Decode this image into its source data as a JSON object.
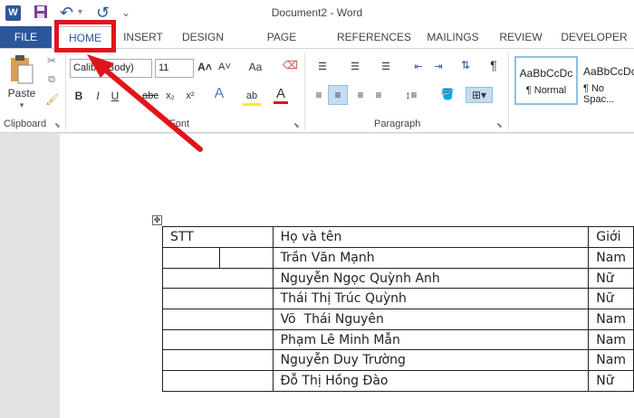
{
  "window": {
    "title": "Document2 - Word"
  },
  "qat": {
    "word_icon": "W",
    "save_icon": "save-icon",
    "undo_icon": "↶",
    "redo_icon": "↺",
    "customize_icon": "⌄"
  },
  "tabs": [
    "FILE",
    "HOME",
    "INSERT",
    "DESIGN",
    "PAGE LAYOUT",
    "REFERENCES",
    "MAILINGS",
    "REVIEW",
    "DEVELOPER"
  ],
  "ribbon": {
    "clipboard": {
      "label": "Clipboard",
      "paste": "Paste"
    },
    "font": {
      "label": "Font",
      "font_name": "Calibri (Body)",
      "font_size": "11",
      "bold": "B",
      "italic": "I",
      "underline": "U",
      "strike": "abc",
      "subscript": "x₂",
      "superscript": "x²",
      "grow": "A˄",
      "shrink": "A˅",
      "case": "Aa",
      "effects": "A",
      "highlight": "ab",
      "color": "A"
    },
    "paragraph": {
      "label": "Paragraph",
      "pilcrow": "¶"
    },
    "styles": [
      {
        "preview": "AaBbCcDc",
        "name": "¶ Normal"
      },
      {
        "preview": "AaBbCcDc",
        "name": "¶ No Spac..."
      }
    ]
  },
  "table": {
    "header": [
      "STT",
      "Họ và tên",
      "Giới"
    ],
    "rows": [
      [
        "",
        "Trần Văn Mạnh",
        "Nam"
      ],
      [
        "",
        "Nguyễn Ngọc Quỳnh Anh",
        "Nữ"
      ],
      [
        "",
        "Thái Thị Trúc Quỳnh",
        "Nữ"
      ],
      [
        "",
        "Võ  Thái Nguyên",
        "Nam"
      ],
      [
        "",
        "Phạm Lê Minh Mẫn",
        "Nam"
      ],
      [
        "",
        "Nguyễn Duy Trường",
        "Nam"
      ],
      [
        "",
        "Đỗ Thị Hồng Đào",
        "Nữ"
      ]
    ]
  },
  "annotation": {
    "color": "#e0151b"
  },
  "colors": {
    "accent": "#2b579a",
    "highlight": "#e0151b"
  }
}
